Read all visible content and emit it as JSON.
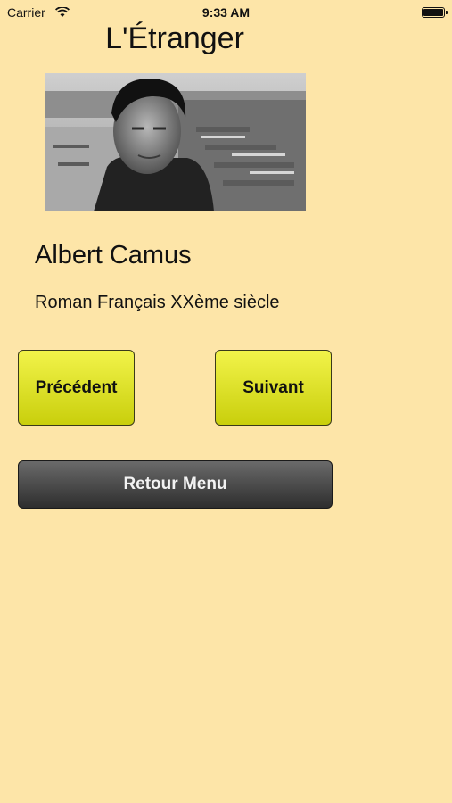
{
  "status_bar": {
    "carrier": "Carrier",
    "time": "9:33 AM"
  },
  "page": {
    "title": "L'Étranger"
  },
  "book": {
    "author": "Albert Camus",
    "genre": "Roman Français XXème siècle",
    "photo_icon": "author-photo"
  },
  "buttons": {
    "previous": "Précédent",
    "next": "Suivant",
    "back_menu": "Retour Menu"
  },
  "colors": {
    "background": "#fde5a8",
    "yellow_button": "#e6e82a",
    "dark_button": "#444444"
  }
}
